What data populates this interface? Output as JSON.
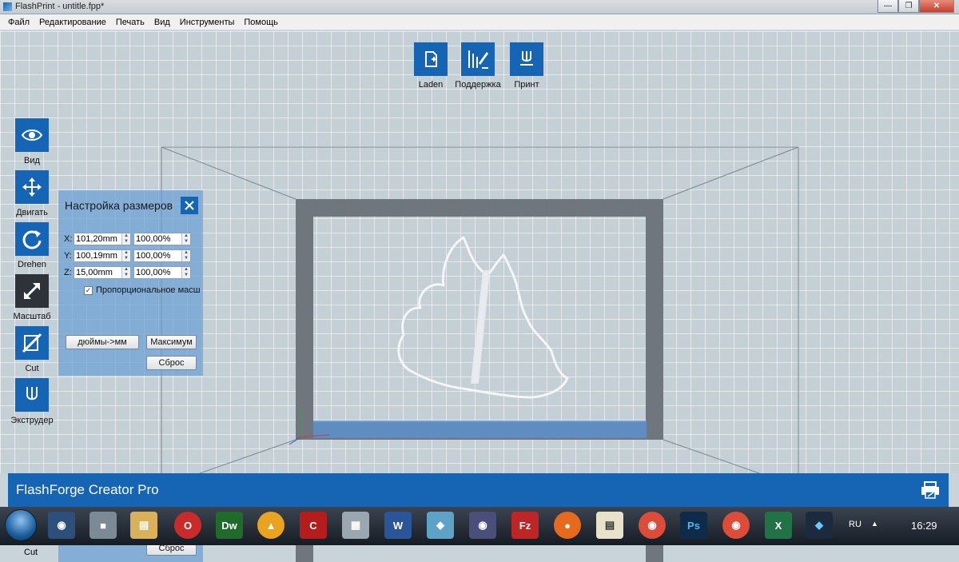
{
  "window": {
    "title": "FlashPrint - untitle.fpp*",
    "minimize_icon": "minimize-icon",
    "restore_icon": "restore-icon",
    "close_icon": "close-icon"
  },
  "menu": {
    "items": [
      "Файл",
      "Редактирование",
      "Печать",
      "Вид",
      "Инструменты",
      "Помощь"
    ]
  },
  "top_toolbar": {
    "load": {
      "label": "Laden",
      "icon": "load-file-icon"
    },
    "supports": {
      "label": "Поддержка",
      "icon": "supports-icon"
    },
    "print": {
      "label": "Принт",
      "icon": "print-nozzle-icon"
    }
  },
  "left_toolbar": {
    "view": {
      "label": "Вид",
      "icon": "eye-icon"
    },
    "move": {
      "label": "Двигать",
      "icon": "move-arrows-icon"
    },
    "rotate": {
      "label": "Drehen",
      "icon": "rotate-icon"
    },
    "scale": {
      "label": "Масштаб",
      "icon": "scale-diagonal-icon"
    },
    "cut": {
      "label": "Cut",
      "icon": "cut-icon"
    },
    "extruder": {
      "label": "Экструдер",
      "icon": "extruder-nozzle-icon"
    }
  },
  "scale_panel": {
    "title": "Настройка размеров",
    "rows": [
      {
        "axis": "X:",
        "size": "101,20mm",
        "percent": "100,00%"
      },
      {
        "axis": "Y:",
        "size": "100,19mm",
        "percent": "100,00%"
      },
      {
        "axis": "Z:",
        "size": "15,00mm",
        "percent": "100,00%"
      }
    ],
    "proportional_label": "Пропорциональное масш",
    "proportional_checked": true,
    "inch_to_mm_button": "дюймы->мм",
    "maximum_button": "Максимум",
    "reset_button": "Сброс"
  },
  "status": {
    "printer_name": "FlashForge Creator Pro",
    "icon": "printer-status-icon"
  },
  "taskbar": {
    "apps": [
      "start-orb",
      "lock-app",
      "paint",
      "file-explorer",
      "opera",
      "dreamweaver",
      "archiver",
      "cad-app",
      "calculator",
      "word",
      "cube-app",
      "flashprint",
      "filezilla",
      "firefox",
      "notepad-chart",
      "chrome",
      "photoshop",
      "chrome-alt",
      "excel",
      "flashforge"
    ],
    "language": "RU",
    "time": "16:29"
  },
  "remnant": {
    "cut_label": "Cut",
    "reset_label": "Сброс"
  },
  "colors": {
    "accent_blue": "#1565b4",
    "panel_blue": "#69a0d4",
    "active_tool": "#2d3339"
  }
}
